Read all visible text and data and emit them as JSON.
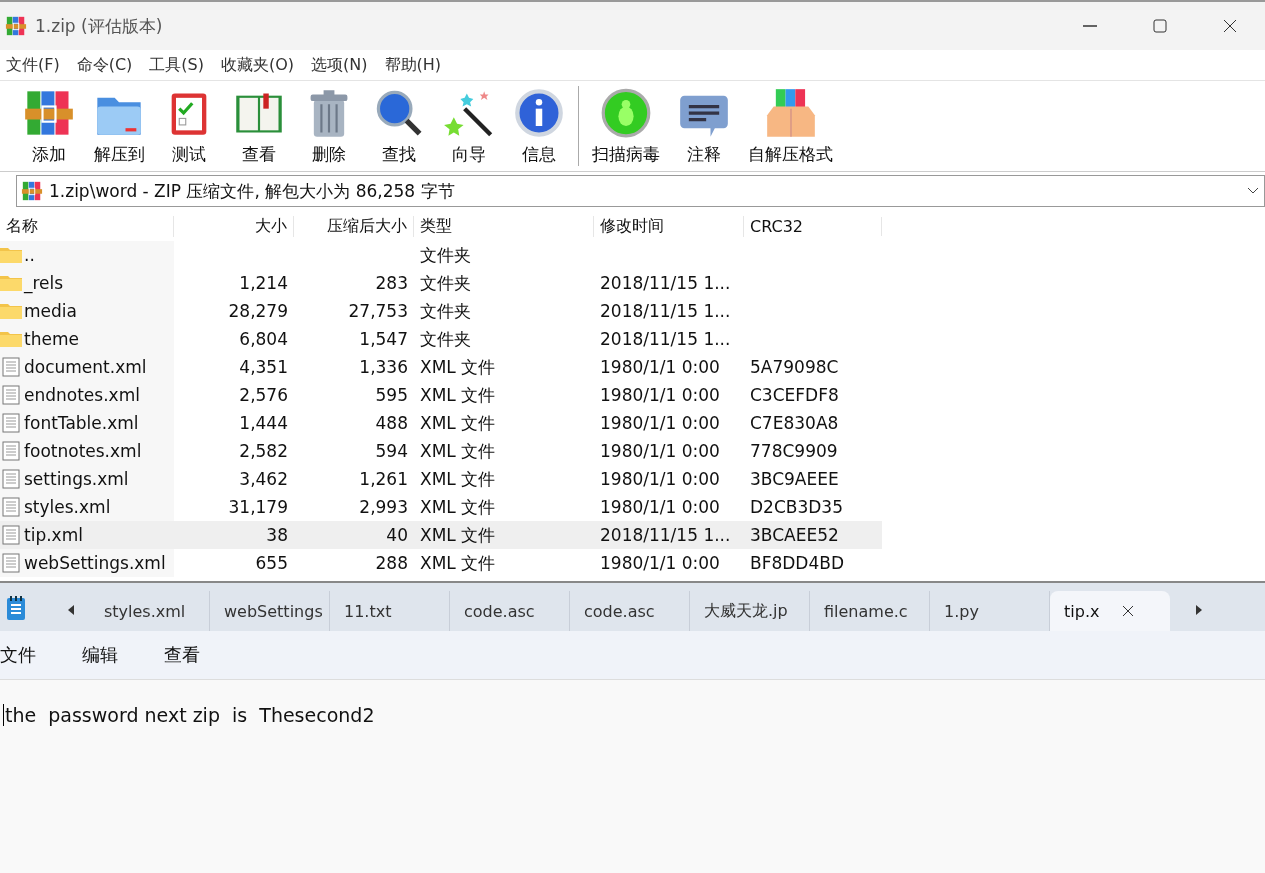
{
  "window": {
    "title": "1.zip (评估版本)"
  },
  "menu": [
    "文件(F)",
    "命令(C)",
    "工具(S)",
    "收藏夹(O)",
    "选项(N)",
    "帮助(H)"
  ],
  "toolbar": [
    "添加",
    "解压到",
    "测试",
    "查看",
    "删除",
    "查找",
    "向导",
    "信息",
    "扫描病毒",
    "注释",
    "自解压格式"
  ],
  "address": "1.zip\\word - ZIP 压缩文件, 解包大小为 86,258 字节",
  "table": {
    "columns": [
      "名称",
      "大小",
      "压缩后大小",
      "类型",
      "修改时间",
      "CRC32"
    ],
    "rows": [
      {
        "kind": "folder",
        "selected": false,
        "cells": [
          "..",
          "",
          "",
          "文件夹",
          "",
          ""
        ]
      },
      {
        "kind": "folder",
        "selected": false,
        "cells": [
          "_rels",
          "1,214",
          "283",
          "文件夹",
          "2018/11/15 1...",
          ""
        ]
      },
      {
        "kind": "folder",
        "selected": false,
        "cells": [
          "media",
          "28,279",
          "27,753",
          "文件夹",
          "2018/11/15 1...",
          ""
        ]
      },
      {
        "kind": "folder",
        "selected": false,
        "cells": [
          "theme",
          "6,804",
          "1,547",
          "文件夹",
          "2018/11/15 1...",
          ""
        ]
      },
      {
        "kind": "file",
        "selected": false,
        "cells": [
          "document.xml",
          "4,351",
          "1,336",
          "XML 文件",
          "1980/1/1 0:00",
          "5A79098C"
        ]
      },
      {
        "kind": "file",
        "selected": false,
        "cells": [
          "endnotes.xml",
          "2,576",
          "595",
          "XML 文件",
          "1980/1/1 0:00",
          "C3CEFDF8"
        ]
      },
      {
        "kind": "file",
        "selected": false,
        "cells": [
          "fontTable.xml",
          "1,444",
          "488",
          "XML 文件",
          "1980/1/1 0:00",
          "C7E830A8"
        ]
      },
      {
        "kind": "file",
        "selected": false,
        "cells": [
          "footnotes.xml",
          "2,582",
          "594",
          "XML 文件",
          "1980/1/1 0:00",
          "778C9909"
        ]
      },
      {
        "kind": "file",
        "selected": false,
        "cells": [
          "settings.xml",
          "3,462",
          "1,261",
          "XML 文件",
          "1980/1/1 0:00",
          "3BC9AEEE"
        ]
      },
      {
        "kind": "file",
        "selected": false,
        "cells": [
          "styles.xml",
          "31,179",
          "2,993",
          "XML 文件",
          "1980/1/1 0:00",
          "D2CB3D35"
        ]
      },
      {
        "kind": "file",
        "selected": true,
        "cells": [
          "tip.xml",
          "38",
          "40",
          "XML 文件",
          "2018/11/15 1...",
          "3BCAEE52"
        ]
      },
      {
        "kind": "file",
        "selected": false,
        "cells": [
          "webSettings.xml",
          "655",
          "288",
          "XML 文件",
          "1980/1/1 0:00",
          "BF8DD4BD"
        ]
      }
    ]
  },
  "notepad": {
    "tabs": [
      {
        "label": "styles.xml",
        "selected": false
      },
      {
        "label": "webSettings",
        "selected": false
      },
      {
        "label": "11.txt",
        "selected": false
      },
      {
        "label": "code.asc",
        "selected": false
      },
      {
        "label": "code.asc",
        "selected": false
      },
      {
        "label": "大威天龙.jp",
        "selected": false
      },
      {
        "label": "filename.c",
        "selected": false
      },
      {
        "label": "1.py",
        "selected": false
      },
      {
        "label": "tip.x",
        "selected": true
      }
    ],
    "menu": [
      "文件",
      "编辑",
      "查看"
    ],
    "text": "the  password next zip  is  Thesecond2"
  }
}
